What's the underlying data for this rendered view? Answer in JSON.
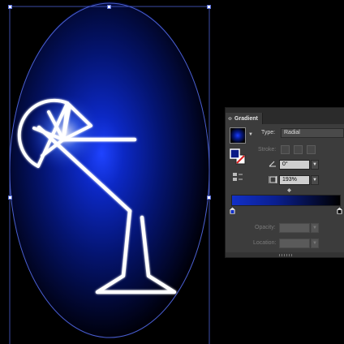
{
  "colors": {
    "canvas_bg": "#000000",
    "selection": "#4a5fd0",
    "glow_center": "#1a3cff",
    "panel_bg": "#3c3c3c",
    "gradient_start": "#1230c8",
    "gradient_end": "#000000"
  },
  "gradient_panel": {
    "tab_arrows": "≎",
    "title": "Gradient",
    "type_label": "Type:",
    "type_value": "Radial",
    "stroke_label": "Stroke:",
    "angle_value": "0°",
    "aspect_value": "193%",
    "opacity_label": "Opacity:",
    "location_label": "Location:",
    "icons": {
      "preview": "gradient-preview-icon",
      "fill_stroke": "fill-stroke-icon",
      "reverse": "reverse-gradient-icon",
      "angle": "angle-icon",
      "aspect": "aspect-ratio-icon"
    }
  }
}
